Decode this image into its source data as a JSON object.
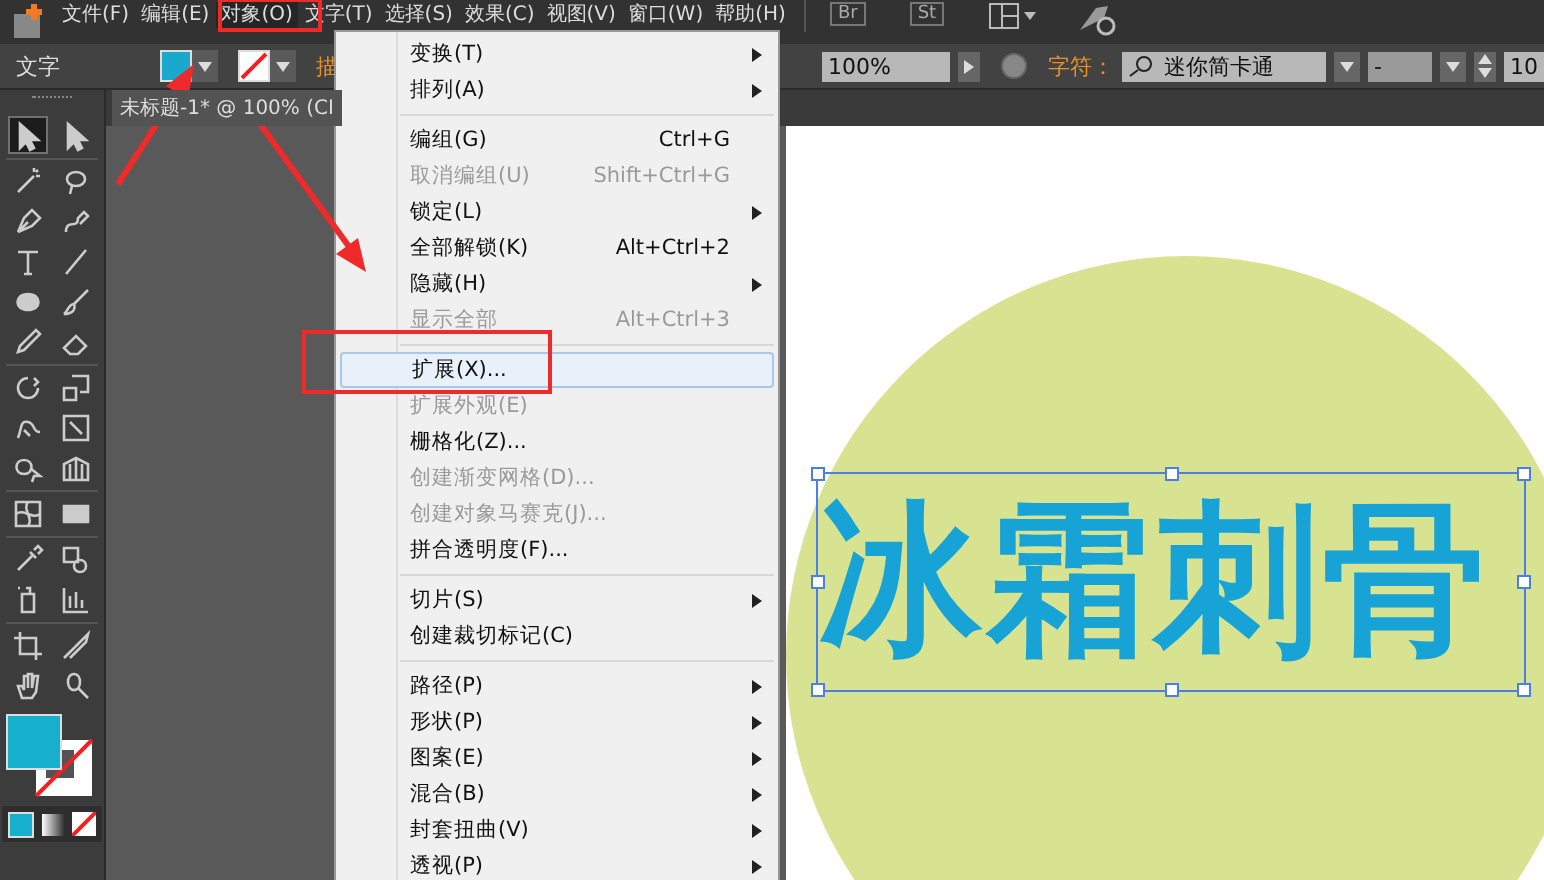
{
  "menu_bar": [
    {
      "label": "文件(F)",
      "selected": false
    },
    {
      "label": "编辑(E)",
      "selected": false
    },
    {
      "label": "对象(O)",
      "selected": true
    },
    {
      "label": "文字(T)",
      "selected": false
    },
    {
      "label": "选择(S)",
      "selected": false
    },
    {
      "label": "效果(C)",
      "selected": false
    },
    {
      "label": "视图(V)",
      "selected": false
    },
    {
      "label": "窗口(W)",
      "selected": false
    },
    {
      "label": "帮助(H)",
      "selected": false
    }
  ],
  "app_buttons": [
    "Br",
    "St"
  ],
  "control_bar": {
    "mode_label": "文字",
    "stroke_label": "描",
    "opacity_value": "100%",
    "character_label": "字符：",
    "font_family": "迷你简卡通",
    "font_style": "-",
    "size_value": "10"
  },
  "document_tab": "未标题-1* @ 100% (CI",
  "tools": [
    {
      "kind": "selection",
      "selected": true
    },
    {
      "kind": "direct-selection",
      "selected": false
    },
    {
      "kind": "magic-wand",
      "selected": false
    },
    {
      "kind": "lasso",
      "selected": false
    },
    {
      "kind": "pen",
      "selected": false
    },
    {
      "kind": "curvature",
      "selected": false
    },
    {
      "kind": "type",
      "selected": false
    },
    {
      "kind": "line",
      "selected": false
    },
    {
      "kind": "ellipse",
      "selected": false
    },
    {
      "kind": "brush",
      "selected": false
    },
    {
      "kind": "pencil",
      "selected": false
    },
    {
      "kind": "eraser",
      "selected": false
    },
    {
      "kind": "rotate",
      "selected": false
    },
    {
      "kind": "scale",
      "selected": false
    },
    {
      "kind": "warp",
      "selected": false
    },
    {
      "kind": "free-transform",
      "selected": false
    },
    {
      "kind": "shape-builder",
      "selected": false
    },
    {
      "kind": "perspective",
      "selected": false
    },
    {
      "kind": "mesh",
      "selected": false
    },
    {
      "kind": "gradient",
      "selected": false
    },
    {
      "kind": "eyedropper",
      "selected": false
    },
    {
      "kind": "blend",
      "selected": false
    },
    {
      "kind": "sprayer",
      "selected": false
    },
    {
      "kind": "graph",
      "selected": false
    },
    {
      "kind": "artboard",
      "selected": false
    },
    {
      "kind": "slice",
      "selected": false
    },
    {
      "kind": "hand",
      "selected": false
    },
    {
      "kind": "zoom",
      "selected": false
    }
  ],
  "object_menu": [
    {
      "kind": "item",
      "label": "变换(T)",
      "submenu": true,
      "disabled": false,
      "selected": false
    },
    {
      "kind": "item",
      "label": "排列(A)",
      "submenu": true,
      "disabled": false,
      "selected": false
    },
    {
      "kind": "separator"
    },
    {
      "kind": "item",
      "label": "编组(G)",
      "shortcut": "Ctrl+G",
      "submenu": false,
      "disabled": false,
      "selected": false
    },
    {
      "kind": "item",
      "label": "取消编组(U)",
      "shortcut": "Shift+Ctrl+G",
      "submenu": false,
      "disabled": true,
      "selected": false
    },
    {
      "kind": "item",
      "label": "锁定(L)",
      "submenu": true,
      "disabled": false,
      "selected": false
    },
    {
      "kind": "item",
      "label": "全部解锁(K)",
      "shortcut": "Alt+Ctrl+2",
      "submenu": false,
      "disabled": false,
      "selected": false
    },
    {
      "kind": "item",
      "label": "隐藏(H)",
      "submenu": true,
      "disabled": false,
      "selected": false
    },
    {
      "kind": "item",
      "label": "显示全部",
      "shortcut": "Alt+Ctrl+3",
      "submenu": false,
      "disabled": true,
      "selected": false
    },
    {
      "kind": "separator"
    },
    {
      "kind": "item",
      "label": "扩展(X)...",
      "submenu": false,
      "disabled": false,
      "selected": true
    },
    {
      "kind": "item",
      "label": "扩展外观(E)",
      "submenu": false,
      "disabled": true,
      "selected": false
    },
    {
      "kind": "item",
      "label": "栅格化(Z)...",
      "submenu": false,
      "disabled": false,
      "selected": false
    },
    {
      "kind": "item",
      "label": "创建渐变网格(D)...",
      "submenu": false,
      "disabled": true,
      "selected": false
    },
    {
      "kind": "item",
      "label": "创建对象马赛克(J)...",
      "submenu": false,
      "disabled": true,
      "selected": false
    },
    {
      "kind": "item",
      "label": "拼合透明度(F)...",
      "submenu": false,
      "disabled": false,
      "selected": false
    },
    {
      "kind": "separator"
    },
    {
      "kind": "item",
      "label": "切片(S)",
      "submenu": true,
      "disabled": false,
      "selected": false
    },
    {
      "kind": "item",
      "label": "创建裁切标记(C)",
      "submenu": false,
      "disabled": false,
      "selected": false
    },
    {
      "kind": "separator"
    },
    {
      "kind": "item",
      "label": "路径(P)",
      "submenu": true,
      "disabled": false,
      "selected": false
    },
    {
      "kind": "item",
      "label": "形状(P)",
      "submenu": true,
      "disabled": false,
      "selected": false
    },
    {
      "kind": "item",
      "label": "图案(E)",
      "submenu": true,
      "disabled": false,
      "selected": false
    },
    {
      "kind": "item",
      "label": "混合(B)",
      "submenu": true,
      "disabled": false,
      "selected": false
    },
    {
      "kind": "item",
      "label": "封套扭曲(V)",
      "submenu": true,
      "disabled": false,
      "selected": false
    },
    {
      "kind": "item",
      "label": "透视(P)",
      "submenu": true,
      "disabled": false,
      "selected": false
    }
  ],
  "canvas": {
    "text": "冰霜刺骨"
  }
}
